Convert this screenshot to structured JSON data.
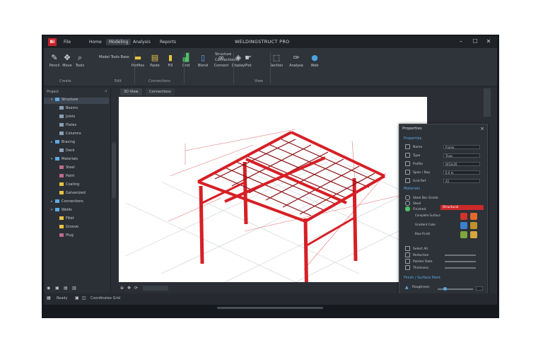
{
  "app": {
    "logo_text": "Bi",
    "title": "WELDINGSTRUCT PRO"
  },
  "menu": [
    "File",
    "Home",
    "Modeling",
    "Analysis",
    "Reports"
  ],
  "window_controls": {
    "minimize": "–",
    "maximize": "☐",
    "close": "✕"
  },
  "ribbon": {
    "buttons": [
      {
        "label": "Pencil",
        "icon": "pencil-icon",
        "color": "#d7dadf"
      },
      {
        "label": "Move",
        "icon": "move-icon",
        "color": "#d7dadf"
      },
      {
        "label": "Tools",
        "icon": "magnifier-icon",
        "color": "#d7dadf"
      },
      {
        "label": "Profiles",
        "icon": "folder-icon",
        "color": "#e8c440"
      },
      {
        "label": "Paste",
        "icon": "clipboard-icon",
        "color": "#e8c440"
      },
      {
        "label": "Fill",
        "icon": "fill-icon",
        "color": "#e8c440"
      },
      {
        "label": "Grid",
        "icon": "chart-icon",
        "color": "#4fbf67"
      },
      {
        "label": "Blend",
        "icon": "document-icon",
        "color": "#5ba9e6"
      },
      {
        "label": "Connect",
        "icon": "link-icon",
        "color": "#c6cbd1"
      },
      {
        "label": "Display",
        "icon": "shapes-icon",
        "color": "#c6cbd1"
      },
      {
        "label": "Plot",
        "icon": "hand-icon",
        "color": "#c6cbd1"
      },
      {
        "label": "Section",
        "icon": "frame-icon",
        "color": "#c6cbd1"
      },
      {
        "label": "Analyse",
        "icon": "pen-tool-icon",
        "color": "#c6cbd1"
      },
      {
        "label": "Web",
        "icon": "globe-icon",
        "color": "#4aa3e0"
      }
    ],
    "small_text": [
      "Model Tools Base",
      "Structure",
      "Connections"
    ],
    "groups": [
      "Create",
      "Edit",
      "Connections",
      "View"
    ]
  },
  "left_panel": {
    "header": "Project",
    "rows": [
      {
        "label": "Structure",
        "indent": 1,
        "color": "#5ba9e6",
        "arrow": "▾",
        "selected": true
      },
      {
        "label": "Beams",
        "indent": 2,
        "color": "#8a9fb5",
        "arrow": "",
        "selected": false
      },
      {
        "label": "Joists",
        "indent": 2,
        "color": "#8a9fb5",
        "arrow": "",
        "selected": false
      },
      {
        "label": "Plates",
        "indent": 2,
        "color": "#8a9fb5",
        "arrow": "",
        "selected": false
      },
      {
        "label": "Columns",
        "indent": 2,
        "color": "#8a9fb5",
        "arrow": "",
        "selected": false
      },
      {
        "label": "Bracing",
        "indent": 1,
        "color": "#5ba9e6",
        "arrow": "▸",
        "selected": false
      },
      {
        "label": "Deck",
        "indent": 2,
        "color": "#8a9fb5",
        "arrow": "",
        "selected": false
      },
      {
        "label": "Materials",
        "indent": 1,
        "color": "#5ba9e6",
        "arrow": "▾",
        "selected": false
      },
      {
        "label": "Steel",
        "indent": 2,
        "color": "#c06a8a",
        "arrow": "",
        "selected": false
      },
      {
        "label": "Paint",
        "indent": 2,
        "color": "#c06a8a",
        "arrow": "",
        "selected": false
      },
      {
        "label": "Coating",
        "indent": 2,
        "color": "#e8c440",
        "arrow": "",
        "selected": false
      },
      {
        "label": "Galvanized",
        "indent": 2,
        "color": "#e8c440",
        "arrow": "",
        "selected": false
      },
      {
        "label": "Connections",
        "indent": 1,
        "color": "#5ba9e6",
        "arrow": "▸",
        "selected": false
      },
      {
        "label": "Welds",
        "indent": 1,
        "color": "#5ba9e6",
        "arrow": "▾",
        "selected": false
      },
      {
        "label": "Fillet",
        "indent": 2,
        "color": "#e8c440",
        "arrow": "",
        "selected": false
      },
      {
        "label": "Groove",
        "indent": 2,
        "color": "#e8c440",
        "arrow": "",
        "selected": false
      },
      {
        "label": "Plug",
        "indent": 2,
        "color": "#c06a8a",
        "arrow": "",
        "selected": false
      }
    ],
    "footer_icons": [
      "eye-icon",
      "lock-icon",
      "layers-icon",
      "filter-icon"
    ]
  },
  "viewport": {
    "tabs": [
      "3D View",
      "Connections"
    ],
    "controls": [
      "zoom-icon",
      "pan-icon",
      "rotate-icon"
    ],
    "frame_color": "#d61f26",
    "rail_color": "#8a0f14"
  },
  "properties": {
    "title": "Properties",
    "sections": {
      "general": "Properties",
      "material": "Materials",
      "finish": "Finish / Surface Paint"
    },
    "general_rows": [
      {
        "label": "Name",
        "value": "Frame"
      },
      {
        "label": "Type",
        "value": "Truss"
      },
      {
        "label": "Profile",
        "value": "W12x26"
      },
      {
        "label": "Span / Bay",
        "value": "6.0 m"
      },
      {
        "label": "Grid Ref",
        "value": "A1"
      }
    ],
    "material_rows": [
      {
        "label": "Steel Bar Grade",
        "checked": false
      },
      {
        "label": "Steel",
        "checked": false
      },
      {
        "label": "Finished",
        "checked": true
      }
    ],
    "material_value": "Structural",
    "swatches": [
      "#d0342c",
      "#e06a2c",
      "#3c7fd0",
      "#c0902c",
      "#7fa53c",
      "#d8a440"
    ],
    "swatch_labels": [
      "Complete Surface",
      "Gradient Color",
      "Blue Finish"
    ],
    "extra_rows": [
      "Select All",
      "Reduction",
      "Painter Rate",
      "Thickness"
    ],
    "slider_label": "Roughness",
    "slider_value": 0.2
  },
  "status": {
    "items": [
      "Ready",
      "Coordinates Grid"
    ],
    "icons": [
      "grid-icon",
      "snap-icon",
      "ortho-icon"
    ]
  }
}
